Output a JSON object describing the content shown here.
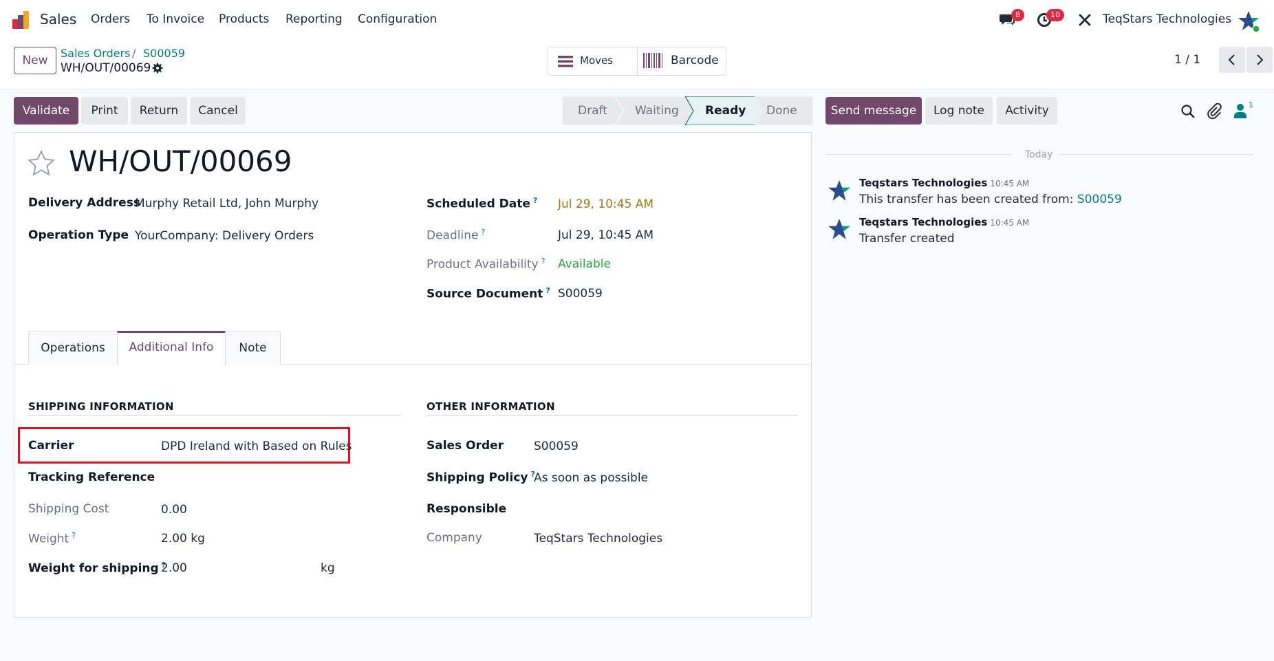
{
  "navbar": {
    "app_name": "Sales",
    "menu": [
      "Orders",
      "To Invoice",
      "Products",
      "Reporting",
      "Configuration"
    ],
    "messages_count": "8",
    "activities_count": "10",
    "company": "TeqStars Technologies"
  },
  "control_panel": {
    "new_label": "New",
    "breadcrumb": [
      "Sales Orders",
      "S00059"
    ],
    "record_name": "WH/OUT/00069",
    "smart_buttons": [
      "Moves",
      "Barcode"
    ],
    "pager": "1 / 1"
  },
  "action_buttons": [
    "Validate",
    "Print",
    "Return",
    "Cancel"
  ],
  "statusbar": {
    "stages": [
      "Draft",
      "Waiting",
      "Ready",
      "Done"
    ],
    "current": "Ready"
  },
  "chatter_buttons": [
    "Send message",
    "Log note",
    "Activity"
  ],
  "followers_count": "1",
  "form": {
    "title": "WH/OUT/00069",
    "left_fields": [
      {
        "label": "Delivery Address",
        "value": "Murphy Retail Ltd, John Murphy"
      },
      {
        "label": "Operation Type",
        "value": "YourCompany: Delivery Orders"
      }
    ],
    "right_fields": [
      {
        "label": "Scheduled Date",
        "value": "Jul 29, 10:45 AM"
      },
      {
        "label": "Deadline",
        "value": "Jul 29, 10:45 AM"
      },
      {
        "label": "Product Availability",
        "value": "Available"
      },
      {
        "label": "Source Document",
        "value": "S00059"
      }
    ],
    "tabs": [
      "Operations",
      "Additional Info",
      "Note"
    ],
    "active_tab": "Additional Info",
    "shipping": {
      "title": "SHIPPING INFORMATION",
      "carrier_label": "Carrier",
      "carrier_value": "DPD Ireland with Based on Rules",
      "tracking_label": "Tracking Reference",
      "cost_label": "Shipping Cost",
      "cost_value": "0.00",
      "weight_label": "Weight",
      "weight_value": "2.00",
      "weight_unit": "kg",
      "ship_weight_label": "Weight for shipping",
      "ship_weight_value": "2.00",
      "ship_weight_unit": "kg"
    },
    "other": {
      "title": "OTHER INFORMATION",
      "sales_order_label": "Sales Order",
      "sales_order_value": "S00059",
      "policy_label": "Shipping Policy",
      "policy_value": "As soon as possible",
      "responsible_label": "Responsible",
      "company_label": "Company",
      "company_value": "TeqStars Technologies"
    }
  },
  "chatter": {
    "date_separator": "Today",
    "messages": [
      {
        "author": "Teqstars Technologies",
        "time": "10:45 AM",
        "text": "This transfer has been created from:",
        "link": "S00059"
      },
      {
        "author": "Teqstars Technologies",
        "time": "10:45 AM",
        "text": "Transfer created"
      }
    ]
  },
  "colors": {
    "primary": "#71486a",
    "link": "#017e84",
    "warning_date": "#a07a10",
    "success": "#28a745",
    "highlight_box": "#e8101e",
    "badge": "#e0283e"
  }
}
